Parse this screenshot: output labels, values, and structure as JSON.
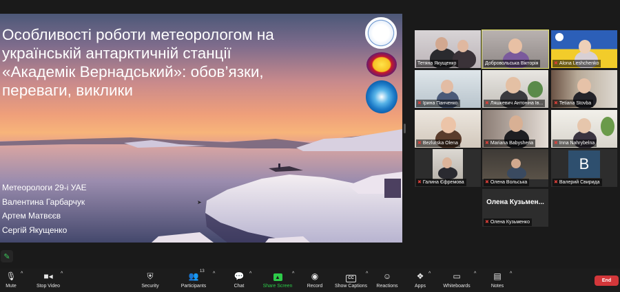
{
  "slide": {
    "title_lines": [
      "Особливості роботи метеорологом на",
      "українській антарктичній станції",
      "«Академік Вернадський»: обов’язки,",
      "переваги, виклики"
    ],
    "authors": [
      "Метеорологи 29-і УАЕ",
      "Валентина Гарбарчук",
      "Артем Матвєєв",
      "Сергій Якущенко"
    ],
    "logos": [
      "antarctic-center-logo",
      "akademik-vernadsky-station-logo",
      "expedition-logo"
    ]
  },
  "participants": [
    {
      "name": "Тетяна Якущенко",
      "muted": false
    },
    {
      "name": "Добровольська Вікторія",
      "muted": false,
      "active_speaker": true
    },
    {
      "name": "Alona Leshchenko",
      "muted": true
    },
    {
      "name": "Ірина Панченко",
      "muted": true
    },
    {
      "name": "Ляшкевич Антоніна Ів...",
      "muted": true
    },
    {
      "name": "Tetiana Stovba",
      "muted": true
    },
    {
      "name": "Bezlutska Olena",
      "muted": true
    },
    {
      "name": "Mariana Babyshena",
      "muted": true
    },
    {
      "name": "Inna Nahrybelna",
      "muted": true
    },
    {
      "name": "Галина Єфремова",
      "muted": true
    },
    {
      "name": "Олена Вольська",
      "muted": true
    },
    {
      "name": "Валерий Свирида",
      "muted": true,
      "avatar_letter": "B"
    },
    {
      "name": "Олена Кузьменко",
      "muted": true,
      "display_text": "Олена  Кузьмен..."
    }
  ],
  "toolbar": {
    "mute": "Mute",
    "stop_video": "Stop Video",
    "security": "Security",
    "participants": "Participants",
    "participants_count": "13",
    "chat": "Chat",
    "share_screen": "Share Screen",
    "record": "Record",
    "show_captions": "Show Captions",
    "captions_badge": "CC",
    "reactions": "Reactions",
    "apps": "Apps",
    "whiteboards": "Whiteboards",
    "notes": "Notes",
    "end": "End"
  },
  "colors": {
    "end_button": "#d3373a",
    "share_screen": "#2ecb4a",
    "active_speaker_border": "#e8e86a",
    "muted_icon": "#e0403a"
  }
}
